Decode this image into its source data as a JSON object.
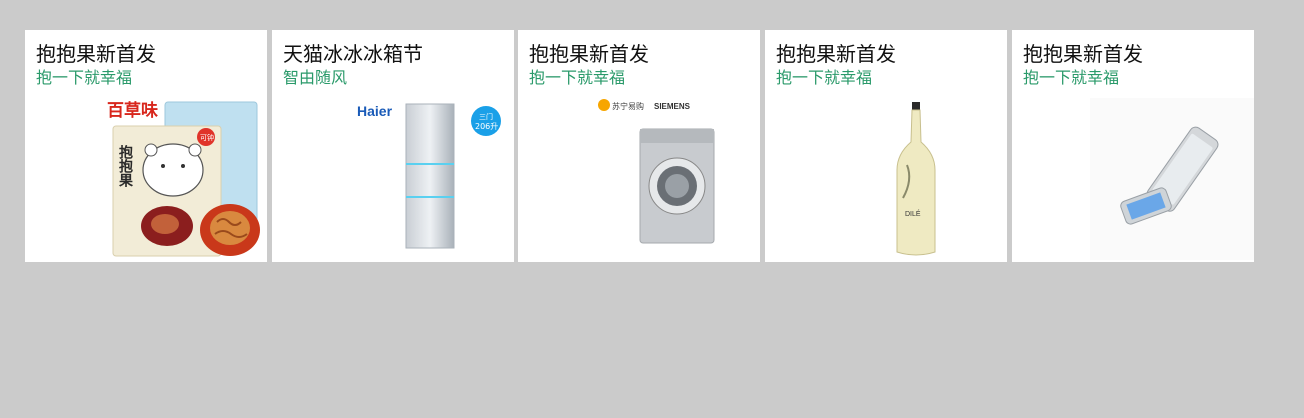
{
  "cards": [
    {
      "title": "抱抱果新首发",
      "subtitle": "抱一下就幸福",
      "brand": "百草味",
      "product_text": "抱抱果",
      "badge": "可钟"
    },
    {
      "title": "天猫冰冰冰箱节",
      "subtitle": "智由随风",
      "brand": "Haier",
      "badge_line1": "三门",
      "badge_line2": "206升"
    },
    {
      "title": "抱抱果新首发",
      "subtitle": "抱一下就幸福",
      "brand_left": "苏宁易购",
      "brand_right": "SIEMENS"
    },
    {
      "title": "抱抱果新首发",
      "subtitle": "抱一下就幸福",
      "label_text": "DILÉ"
    },
    {
      "title": "抱抱果新首发",
      "subtitle": "抱一下就幸福"
    }
  ],
  "colors": {
    "page_background": "#cbcbcb",
    "card_background": "#ffffff",
    "title": "#111111",
    "subtitle": "#2a9a6a"
  }
}
